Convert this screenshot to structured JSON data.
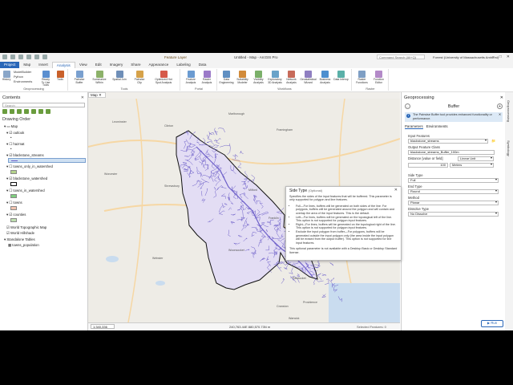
{
  "window": {
    "title": "Untitled - Map - ArcGIS Pro",
    "context_tab": "Feature Layer",
    "search_placeholder": "Command Search (Alt+Q)",
    "user": "Forrest (University of Massachusetts Amherst)"
  },
  "ribbon_tabs": [
    "Project",
    "Map",
    "Insert",
    "Analysis",
    "View",
    "Edit",
    "Imagery",
    "Share",
    "Appearance",
    "Labeling",
    "Data"
  ],
  "ribbon": {
    "geoprocessing": {
      "label": "Geoprocessing",
      "history": "History",
      "items": [
        "ModelBuilder",
        "Python",
        "Environments"
      ],
      "ready_tools": "Ready To Use Tools",
      "tools": "Tools"
    },
    "tools_group": {
      "label": "Tools",
      "buttons": [
        "Pairwise Buffer",
        "Summarize Within",
        "Spatial Join",
        "Pairwise Clip",
        "Optimized Hot Spot Analysis"
      ]
    },
    "portal_group": {
      "label": "Portal",
      "buttons": [
        "Feature Analysis",
        "Raster Analysis"
      ]
    },
    "workflows_group": {
      "label": "Workflows",
      "buttons": [
        "Data Engineering",
        "Suitability Modeler",
        "Visibility Analysis",
        "Exploratory 3D Analysis",
        "Network Analysis",
        "Geostatistical Wizard",
        "Business Analysis",
        "Data Interop"
      ]
    },
    "raster_group": {
      "label": "Raster",
      "buttons": [
        "Raster Functions",
        "Function Editor"
      ]
    }
  },
  "contents": {
    "title": "Contents",
    "search_placeholder": "Search",
    "drawing_order": "Drawing Order",
    "map_name": "Map",
    "layers": [
      {
        "name": "outlook",
        "swatch": ""
      },
      {
        "name": "hazmat",
        "swatch": ""
      },
      {
        "name": "blackstone_streams",
        "swatch": "#6d5fc9"
      },
      {
        "name": "towns_only_in_watershed",
        "swatch": "#b4d38b"
      },
      {
        "name": "blackstone_watershed",
        "swatch": "#ffffff"
      },
      {
        "name": "towns_in_watershed",
        "swatch": "#7fcf7f"
      },
      {
        "name": "towns",
        "swatch": "#f2c4b0"
      },
      {
        "name": "counties",
        "swatch": "#bfe0b0"
      },
      {
        "name": "World Topographic Map",
        "swatch": ""
      },
      {
        "name": "World Hillshade",
        "swatch": ""
      }
    ],
    "standalone_tables": "Standalone Tables",
    "tables": [
      "towns_population"
    ]
  },
  "map": {
    "tab": "Map",
    "scale": "1:340,336",
    "coords": "240,763.44E 880,570.73N m",
    "selected": "Selected Features: 0",
    "places": [
      "Leominster",
      "Clinton",
      "Marlborough",
      "Framingham",
      "Worcester",
      "Shrewsbury",
      "Milford",
      "Franklin",
      "Webster",
      "Woonsocket",
      "Pawtucket",
      "Providence",
      "Cranston",
      "Warwick",
      "Attleboro",
      "Foxborough"
    ]
  },
  "popup": {
    "title": "Side Type",
    "title_note": "(Optional)",
    "intro": "Specifies the sides of the input features that will be buffered. This parameter is only supported for polygon and line features.",
    "bullets": [
      "Full—For lines, buffers will be generated on both sides of the line. For polygons, buffers will be generated around the polygon and will contain and overlap the area of the input features. This is the default.",
      "Left—For lines, buffers will be generated on the topological left of the line. This option is not supported for polygon input features.",
      "Right—For lines, buffers will be generated on the topological right of the line. This option is not supported for polygon input features.",
      "Exclude the input polygon from buffer—For polygons, buffers will be generated outside the input polygon only (the area inside the input polygon will be erased from the output buffer). This option is not supported for line input features."
    ],
    "footer": "This optional parameter is not available with a Desktop Basic or Desktop Standard license."
  },
  "geoprocessing": {
    "title": "Geoprocessing",
    "tool": "Buffer",
    "info": "The Pairwise Buffer tool provides enhanced functionality or performance.",
    "tabs": [
      "Parameters",
      "Environments"
    ],
    "params": {
      "input_label": "Input Features",
      "input_value": "blackstone_streams",
      "output_label": "Output Feature Class",
      "output_value": "blackstone_streams_Buffer_100m",
      "distance_label": "Distance [value or field]",
      "distance_mode": "Linear Unit",
      "distance_value": "100",
      "distance_unit": "Meters",
      "side_label": "Side Type",
      "side_value": "Full",
      "end_label": "End Type",
      "end_value": "Round",
      "method_label": "Method",
      "method_value": "Planar",
      "dissolve_label": "Dissolve Type",
      "dissolve_value": "No Dissolve"
    },
    "run": "Run"
  },
  "side_tabs": [
    "Geoprocessing",
    "Symbology"
  ]
}
